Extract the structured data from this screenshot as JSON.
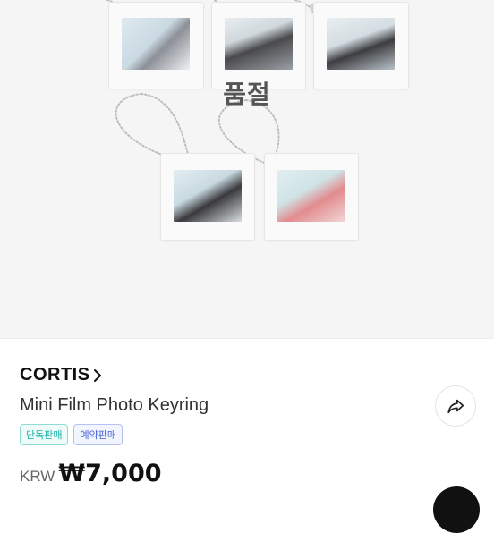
{
  "hero": {
    "soldout_label": "품절"
  },
  "product": {
    "brand": "CORTIS",
    "title": "Mini Film Photo Keyring",
    "badges": [
      "단독판매",
      "예약판매"
    ],
    "currency": "KRW",
    "price": "₩7,000"
  },
  "icons": {
    "brand_chevron": "chevron-right-icon",
    "share": "share-arrow-icon"
  },
  "colors": {
    "badge_exclusive": "#17b3a8",
    "badge_preorder": "#4b67d8",
    "brand_text": "#111111"
  }
}
